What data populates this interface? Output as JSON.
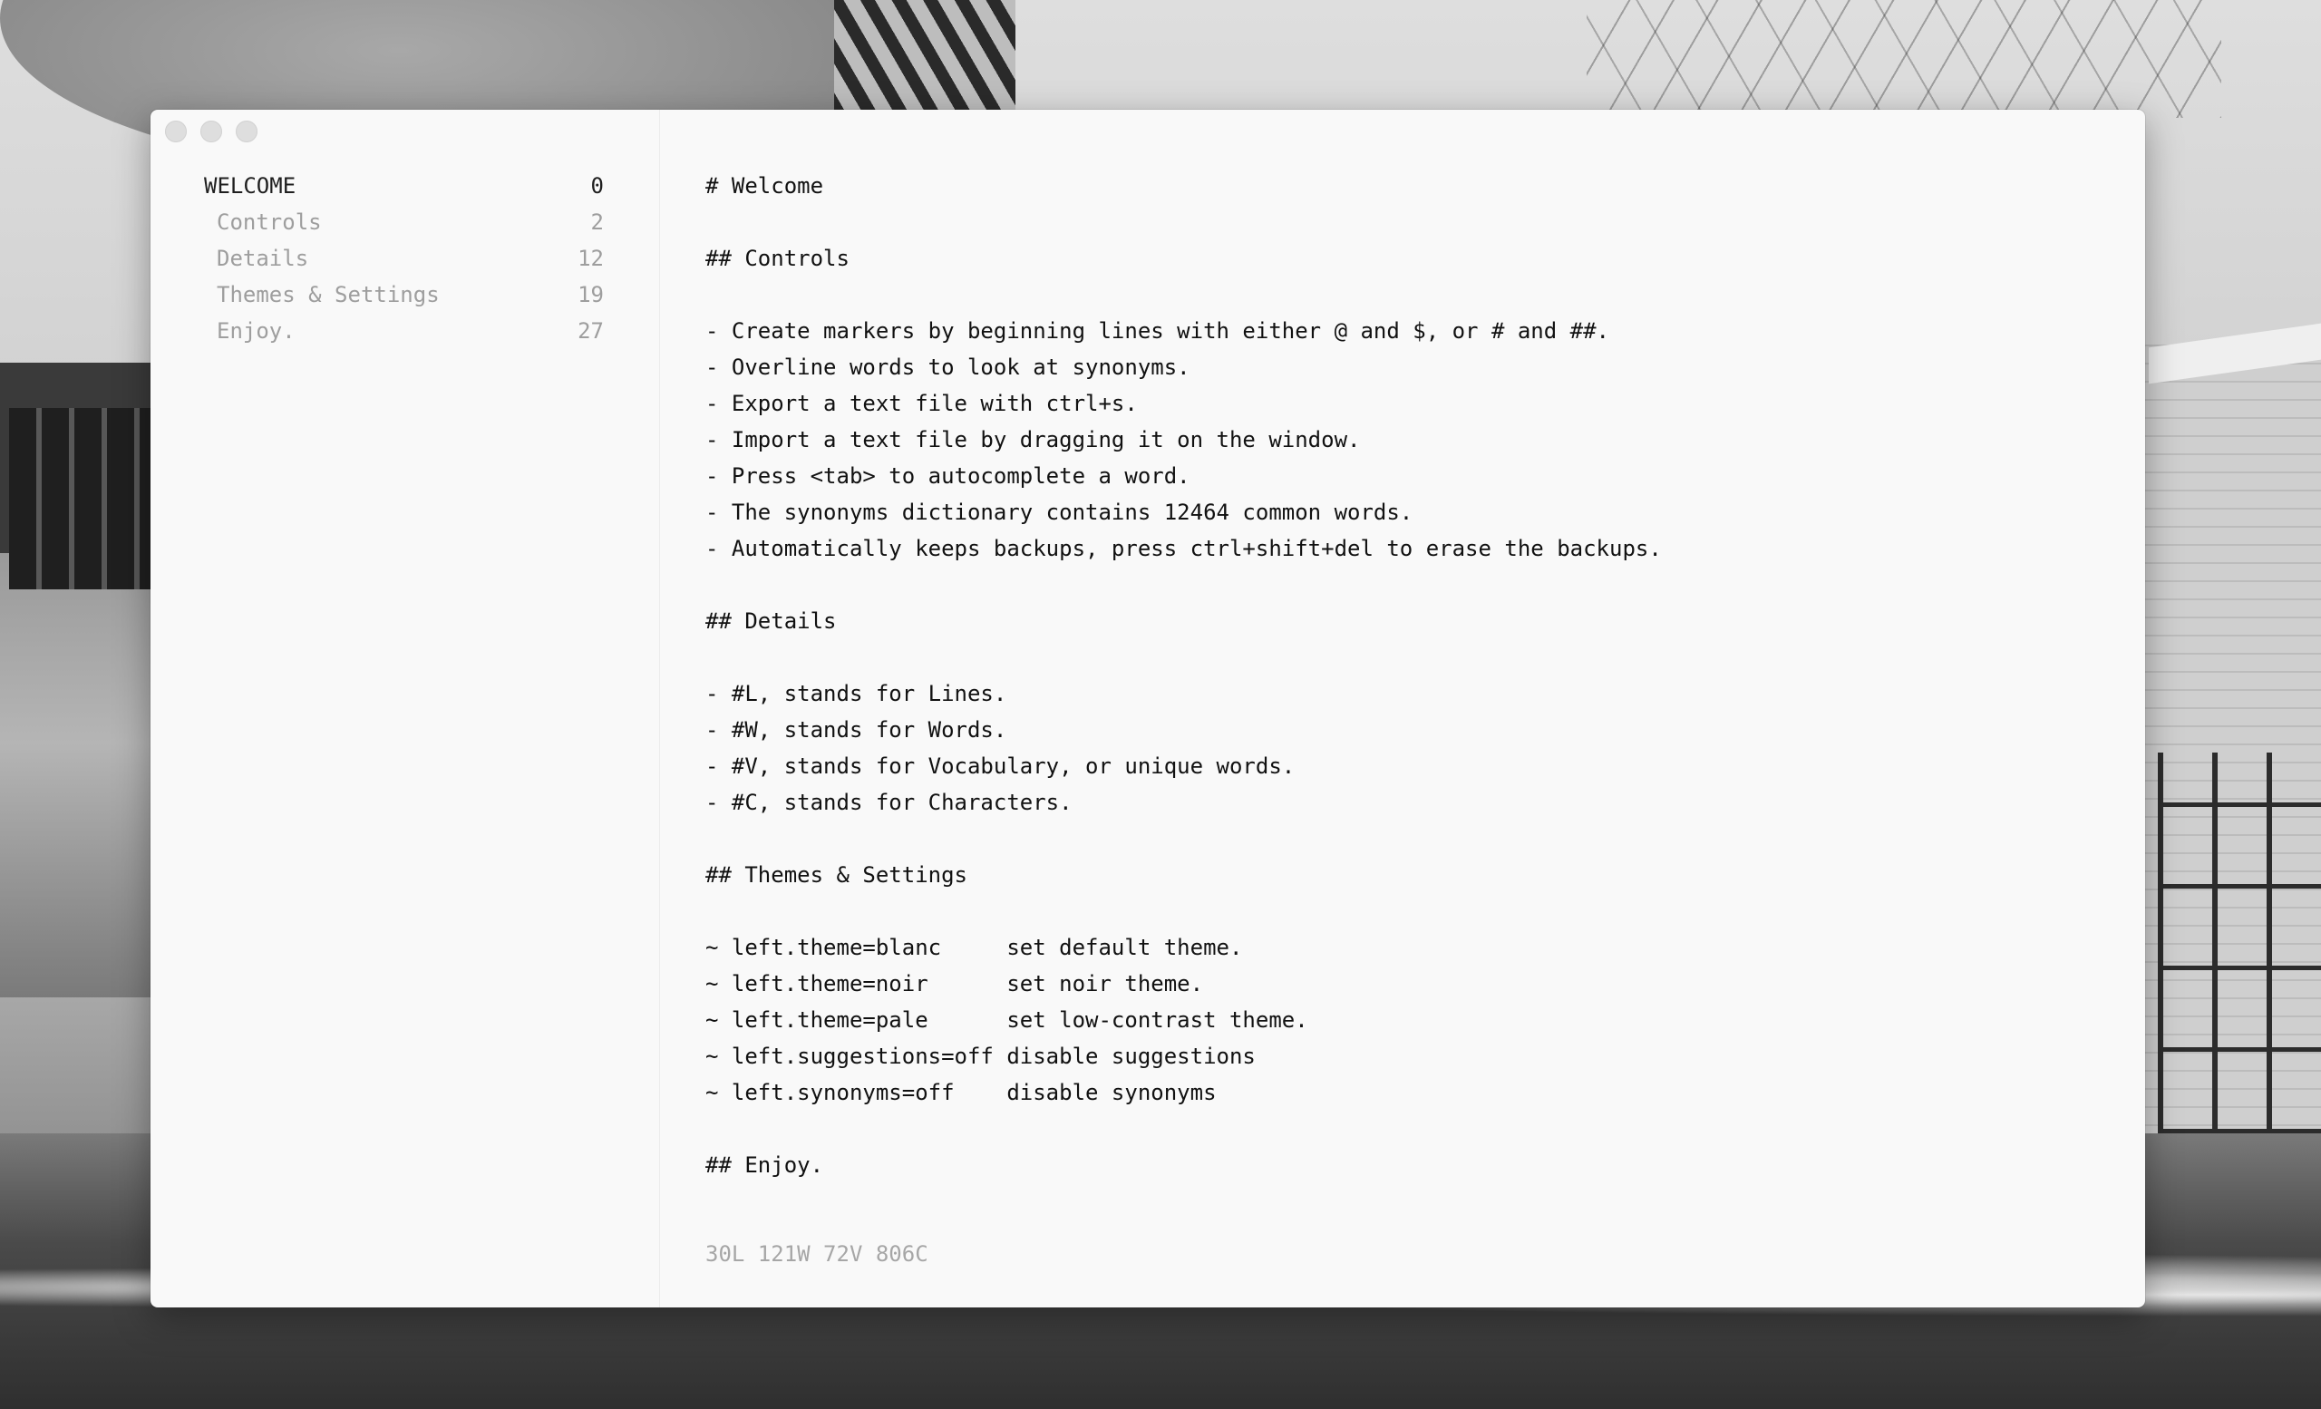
{
  "theme": {
    "window_bg": "#f9f9f9",
    "text": "#111111",
    "muted": "#9e9e9e",
    "divider": "#ececec"
  },
  "window_controls": [
    "close-button",
    "minimize-button",
    "zoom-button"
  ],
  "sidebar": {
    "items": [
      {
        "label": "WELCOME",
        "line": "0",
        "active": true
      },
      {
        "label": "Controls",
        "line": "2",
        "active": false
      },
      {
        "label": "Details",
        "line": "12",
        "active": false
      },
      {
        "label": "Themes & Settings",
        "line": "19",
        "active": false
      },
      {
        "label": "Enjoy.",
        "line": "27",
        "active": false
      }
    ]
  },
  "editor": {
    "lines": [
      "# Welcome",
      "",
      "## Controls",
      "",
      "- Create markers by beginning lines with either @ and $, or # and ##.",
      "- Overline words to look at synonyms.",
      "- Export a text file with ctrl+s.",
      "- Import a text file by dragging it on the window.",
      "- Press <tab> to autocomplete a word.",
      "- The synonyms dictionary contains 12464 common words.",
      "- Automatically keeps backups, press ctrl+shift+del to erase the backups.",
      "",
      "## Details",
      "",
      "- #L, stands for Lines.",
      "- #W, stands for Words.",
      "- #V, stands for Vocabulary, or unique words.",
      "- #C, stands for Characters.",
      "",
      "## Themes & Settings",
      "",
      "~ left.theme=blanc     set default theme.",
      "~ left.theme=noir      set noir theme.",
      "~ left.theme=pale      set low-contrast theme.",
      "~ left.suggestions=off disable suggestions",
      "~ left.synonyms=off    disable synonyms",
      "",
      "## Enjoy."
    ],
    "stats": "30L 121W 72V 806C"
  }
}
